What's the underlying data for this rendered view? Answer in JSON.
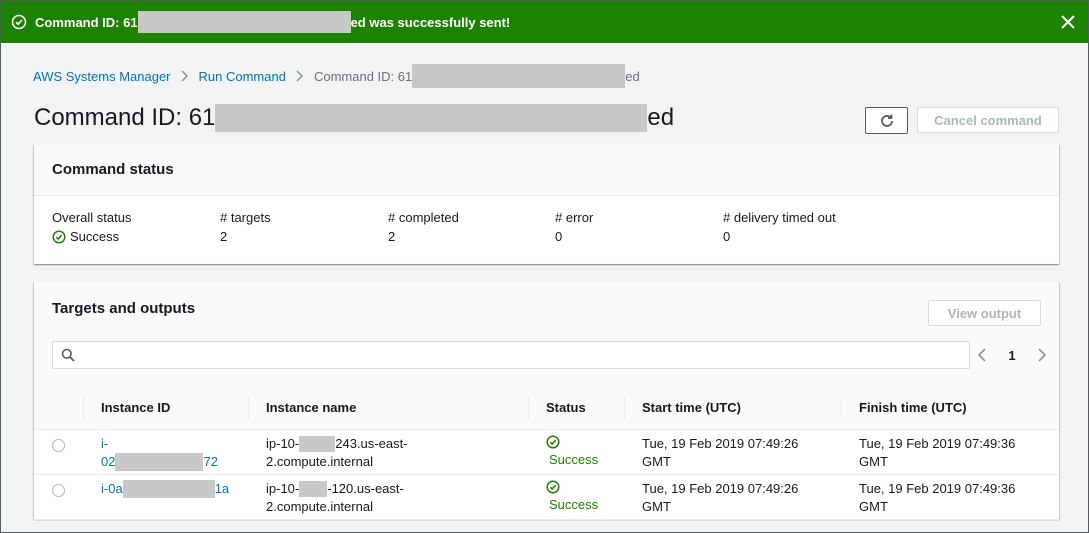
{
  "flash": {
    "prefix": "Command ID: 61",
    "suffix": "ed was successfully sent!",
    "close_icon": "close-icon",
    "status_icon": "check-circle-icon"
  },
  "breadcrumb": {
    "root": "AWS Systems Manager",
    "section": "Run Command",
    "current_prefix": "Command ID: 61",
    "current_suffix": "ed"
  },
  "title": {
    "prefix": "Command ID: 61",
    "suffix": "ed"
  },
  "actions": {
    "refresh_icon": "refresh-icon",
    "cancel_label": "Cancel command"
  },
  "command_status": {
    "header": "Command status",
    "overall_status_label": "Overall status",
    "overall_status_value": "Success",
    "targets_label": "# targets",
    "targets_value": "2",
    "completed_label": "# completed",
    "completed_value": "2",
    "error_label": "# error",
    "error_value": "0",
    "timed_out_label": "# delivery timed out",
    "timed_out_value": "0"
  },
  "targets": {
    "header": "Targets and outputs",
    "view_output_label": "View output",
    "search_placeholder": "",
    "page": "1",
    "columns": [
      "Instance ID",
      "Instance name",
      "Status",
      "Start time (UTC)",
      "Finish time (UTC)"
    ],
    "rows": [
      {
        "id_prefix": "i-",
        "id_line2_prefix": "02",
        "id_suffix": "72",
        "name_prefix": "ip-10-",
        "name_suffix": "243.us-east-",
        "name_line2": "2.compute.internal",
        "status": "Success",
        "start_line1": "Tue, 19 Feb 2019 07:49:26",
        "start_line2": "GMT",
        "finish_line1": "Tue, 19 Feb 2019 07:49:36",
        "finish_line2": "GMT"
      },
      {
        "id_prefix": "i-0a",
        "id_suffix": "1a",
        "name_prefix": "ip-10-",
        "name_suffix": "-120.us-east-",
        "name_line2": "2.compute.internal",
        "status": "Success",
        "start_line1": "Tue, 19 Feb 2019 07:49:26",
        "start_line2": "GMT",
        "finish_line1": "Tue, 19 Feb 2019 07:49:36",
        "finish_line2": "GMT"
      }
    ]
  },
  "colors": {
    "success": "#1d8102",
    "link": "#0073bb",
    "disabled": "#aab7b8"
  }
}
